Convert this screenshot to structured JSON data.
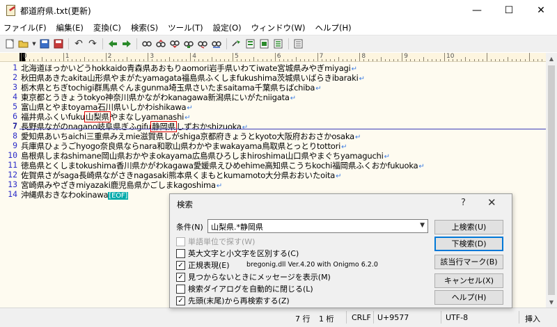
{
  "window": {
    "title": "都道府県.txt(更新)",
    "controls": [
      "—",
      "☐",
      "✕"
    ]
  },
  "menu": [
    "ファイル(F)",
    "編集(E)",
    "変換(C)",
    "検索(S)",
    "ツール(T)",
    "設定(O)",
    "ウィンドウ(W)",
    "ヘルプ(H)"
  ],
  "ruler": {
    "numbers": [
      "0",
      "1",
      "2",
      "3",
      "4",
      "5",
      "6",
      "7",
      "8",
      "9",
      "10"
    ]
  },
  "editor": {
    "line_numbers": [
      "1",
      "2",
      "3",
      "4",
      "5",
      "6",
      "7",
      "8",
      "9",
      "10",
      "11",
      "12",
      "13",
      "14"
    ],
    "current_line": "7",
    "lines": [
      "北海道ほっかいどうhokkaido青森県あおもりaomori岩手県いわてiwate宮城県みやぎmiyagi",
      "秋田県あきたakita山形県やまがたyamagata福島県ふくしまfukushima茨城県いばらきibaraki",
      "栃木県とちぎtochigi群馬県ぐんまgunma埼玉県さいたまsaitama千葉県ちばchiba",
      "東京都とうきょうtokyo神奈川県かながわkanagawa新潟県にいがたniigata",
      "富山県とやまtoyama石川県いしかわishikawa",
      "福井県ふくいfuku",
      "長野県ながのnagano岐阜県ぎふgifu",
      "愛知県あいちaichi三重県みえmie滋賀県しがshiga京都府きょうとkyoto大阪府おおさかosaka",
      "兵庫県ひょうごhyogo奈良県ならnara和歌山県わかやまwakayama鳥取県とっとりtottori",
      "島根県しまねshimane岡山県おかやまokayama広島県ひろしまhiroshima山口県やまぐちyamaguchi",
      "徳島県とくしまtokushima香川県かがわkagawa愛媛県えひめehime高知県こうちkochi福岡県ふくおかfukuoka",
      "佐賀県さがsaga長崎県ながさきnagasaki熊本県くまもとkumamoto大分県おおいたoita",
      "宮崎県みやざきmiyazaki鹿児島県かごしまkagoshima",
      "沖縄県おきなわokinawa"
    ],
    "line6_match": "山梨県",
    "line6_rest": "やまなしyamanashi",
    "line7_match": "静岡県",
    "line7_rest": "しずおかshizuoka",
    "eol": "↵",
    "eof": "[EOF]"
  },
  "status": {
    "line": "7 行",
    "col": "1 桁",
    "newline": "CRLF",
    "char": "U+9577",
    "encoding": "UTF-8",
    "mode": "挿入"
  },
  "dialog": {
    "title": "検索",
    "help": "?",
    "close": "✕",
    "condition_label": "条件(N)",
    "condition_value": "山梨県.*静岡県",
    "options": [
      {
        "label": "単語単位で探す(W)",
        "checked": false,
        "disabled": true
      },
      {
        "label": "英大文字と小文字を区別する(C)",
        "checked": false,
        "disabled": false
      },
      {
        "label": "正規表現(E)",
        "checked": true,
        "disabled": false
      },
      {
        "label": "見つからないときにメッセージを表示(M)",
        "checked": true,
        "disabled": false
      },
      {
        "label": "検索ダイアログを自動的に閉じる(L)",
        "checked": false,
        "disabled": false
      },
      {
        "label": "先頭(末尾)から再検索する(Z)",
        "checked": true,
        "disabled": false
      }
    ],
    "regex_lib": "bregonig.dll Ver.4.20 with Onigmo 6.2.0",
    "buttons": [
      "上検索(U)",
      "下検索(D)",
      "該当行マーク(B)",
      "キャンセル(X)",
      "ヘルプ(H)"
    ]
  },
  "colors": {
    "editor_bg": "#fefbf0",
    "line_number": "#2c2cc8",
    "match_box": "#dd0000",
    "eol_mark": "#3a7ae0",
    "eof_bg": "#00aaaa"
  }
}
